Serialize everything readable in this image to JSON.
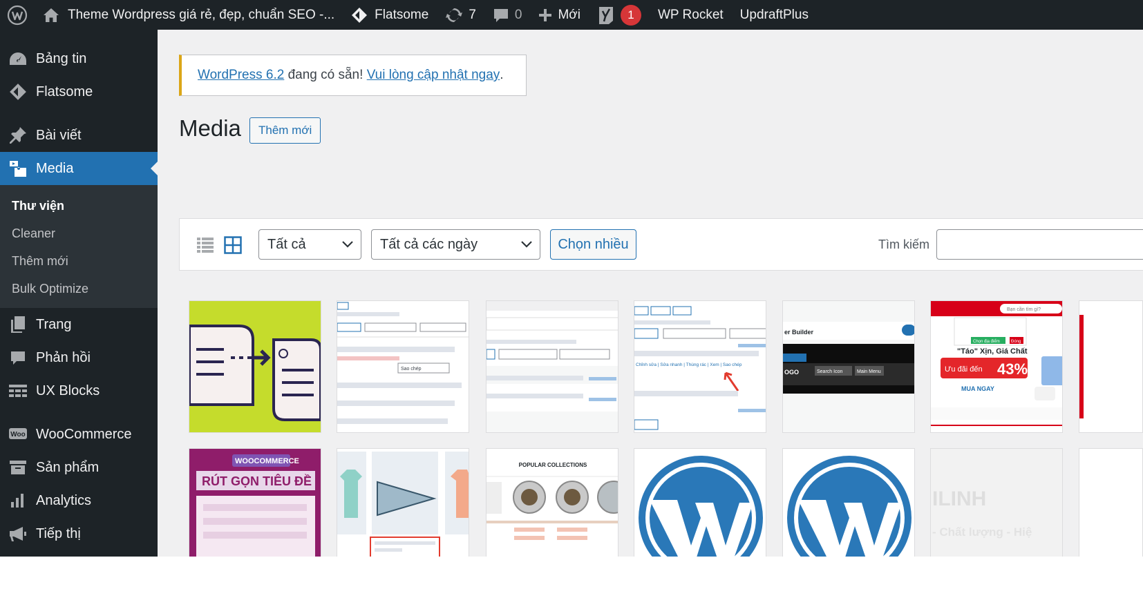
{
  "adminbar": {
    "site_title": "Theme Wordpress giá rẻ, đẹp, chuẩn SEO -...",
    "flatsome": "Flatsome",
    "updates_count": "7",
    "comments_count": "0",
    "new_label": "Mới",
    "yoast_badge": "1",
    "wp_rocket": "WP Rocket",
    "updraftplus": "UpdraftPlus"
  },
  "sidebar": {
    "items": [
      {
        "label": "Bảng tin",
        "icon": "dashboard-icon"
      },
      {
        "label": "Flatsome",
        "icon": "flatsome-icon"
      },
      {
        "label": "Bài viết",
        "icon": "pin-icon"
      },
      {
        "label": "Media",
        "icon": "media-icon"
      },
      {
        "label": "Trang",
        "icon": "page-icon"
      },
      {
        "label": "Phản hồi",
        "icon": "comment-icon"
      },
      {
        "label": "UX Blocks",
        "icon": "blocks-icon"
      },
      {
        "label": "WooCommerce",
        "icon": "woo-icon"
      },
      {
        "label": "Sản phẩm",
        "icon": "archive-icon"
      },
      {
        "label": "Analytics",
        "icon": "chart-icon"
      },
      {
        "label": "Tiếp thị",
        "icon": "megaphone-icon"
      }
    ],
    "submenu": [
      "Thư viện",
      "Cleaner",
      "Thêm mới",
      "Bulk Optimize"
    ]
  },
  "notice": {
    "link1": "WordPress 6.2",
    "middle": " đang có sẵn! ",
    "link2": "Vui lòng cập nhật ngay",
    "end": "."
  },
  "page": {
    "title": "Media",
    "add_new": "Thêm mới"
  },
  "toolbar": {
    "filter_type": "Tất cả",
    "filter_date": "Tất cả các ngày",
    "bulk_select": "Chọn nhiều",
    "search_label": "Tìm kiếm"
  },
  "thumbs": {
    "t2_text": "Sao chép",
    "t4_links": "Chỉnh sửa | Sửa nhanh | Thùng rác | Xem | Sao chép",
    "t5_title": "er Builder",
    "t5_btn1": "Search Icon",
    "t5_btn2": "Main Menu",
    "t5_logo": "OGO",
    "t6_search": "Bạn cần tìm gì?",
    "t6_headline": "\"Táo\" Xịn, Giá Chất",
    "t6_offer": "Ưu đãi đến",
    "t6_pct": "43%",
    "t6_cta": "MUA NGAY",
    "t6_choose": "Chọn địa điểm",
    "t6_close": "Đóng",
    "t7_brand": "WOOCOMMERCE",
    "t7_title": "RÚT GỌN TIÊU ĐỀ",
    "t9_title": "POPULAR COLLECTIONS",
    "t12_text": "ILINH",
    "t12_sub": "- Chất lượng - Hiệ"
  },
  "colors": {
    "adminbar_bg": "#1d2327",
    "accent": "#2271b1",
    "notice_border": "#dba617",
    "badge": "#d63638"
  }
}
